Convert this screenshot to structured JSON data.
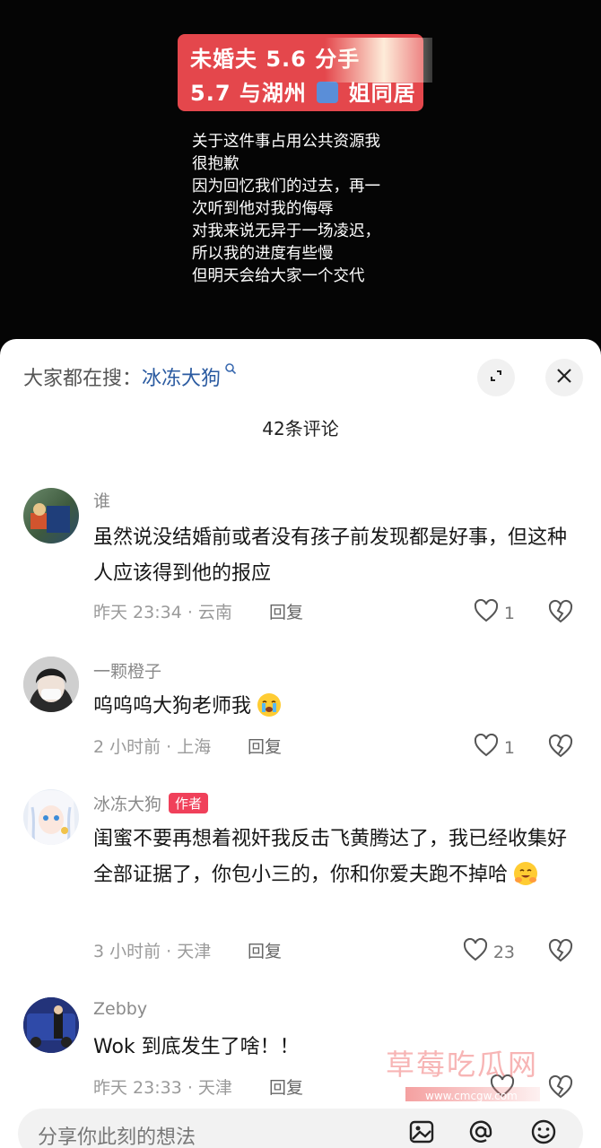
{
  "video": {
    "banner_line1": "未婚夫 5.6 分手",
    "banner_line2": "5.7 与湖州",
    "banner_line2_tail": "姐同居",
    "text_lines": [
      "关于这件事占用公共资源我",
      "很抱歉",
      "因为回忆我们的过去，再一",
      "次听到他对我的侮辱",
      "对我来说无异于一场凌迟，",
      "所以我的进度有些慢",
      "但明天会给大家一个交代"
    ]
  },
  "search": {
    "prefix": "大家都在搜：",
    "term": "冰冻大狗"
  },
  "comments_count": "42条评论",
  "comments": [
    {
      "name": "谁",
      "text": "虽然说没结婚前或者没有孩子前发现都是好事，但这种人应该得到他的报应",
      "meta": "昨天 23:34 · 云南",
      "reply": "回复",
      "likes": "1"
    },
    {
      "name": "一颗橙子",
      "text": "呜呜呜大狗老师我",
      "meta": "2 小时前 · 上海",
      "reply": "回复",
      "likes": "1"
    },
    {
      "name": "冰冻大狗",
      "tag": "作者",
      "text": "闺蜜不要再想着视奸我反击飞黄腾达了，我已经收集好全部证据了，你包小三的，你和你爱夫跑不掉哈",
      "meta": "3 小时前 · 天津",
      "reply": "回复",
      "likes": "23"
    },
    {
      "name": "Zebby",
      "text": "Wok 到底发生了啥！！",
      "meta": "昨天 23:33 · 天津",
      "reply": "回复",
      "likes": ""
    }
  ],
  "input": {
    "placeholder": "分享你此刻的想法"
  },
  "watermark": {
    "text": "草莓吃瓜网",
    "url": "www.cmcgw.com"
  },
  "colors": {
    "banner": "#e4474c",
    "author_tag": "#f0405a",
    "search_term": "#2a5aa0"
  }
}
